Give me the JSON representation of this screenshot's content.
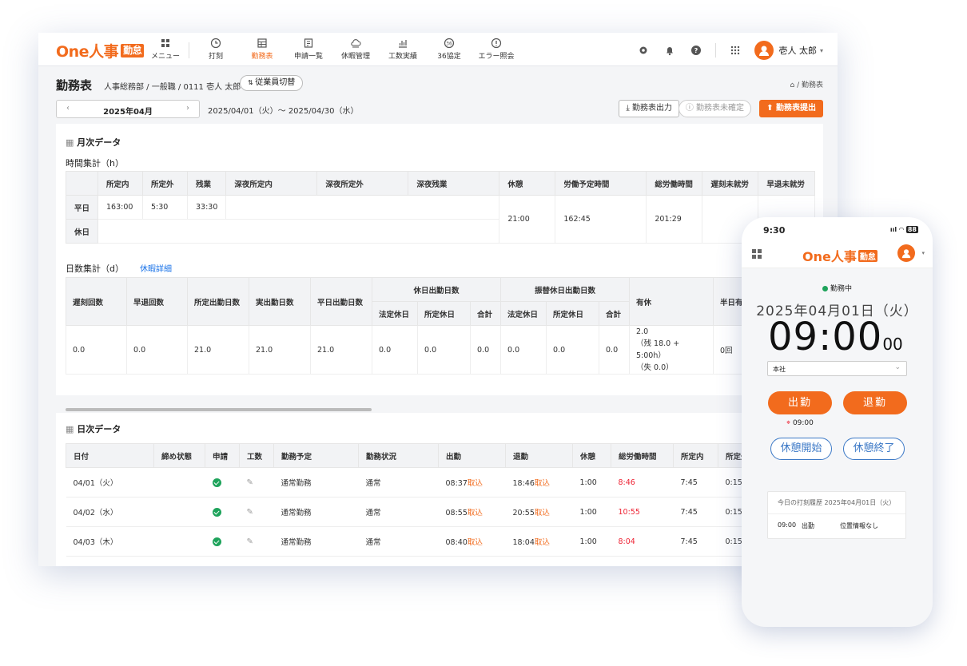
{
  "app": {
    "logo_text": "One人事",
    "logo_badge": "勤怠",
    "brand_color": "#f26b1d"
  },
  "nav": {
    "items": [
      {
        "label": "メニュー",
        "icon": "grid-icon"
      },
      {
        "label": "打刻",
        "icon": "clock-icon"
      },
      {
        "label": "勤務表",
        "icon": "table-icon",
        "active": true
      },
      {
        "label": "申請一覧",
        "icon": "document-icon"
      },
      {
        "label": "休暇管理",
        "icon": "cloud-icon"
      },
      {
        "label": "工数実績",
        "icon": "chart-icon"
      },
      {
        "label": "36協定",
        "icon": "timer-36-icon"
      },
      {
        "label": "エラー照会",
        "icon": "alert-icon"
      }
    ],
    "user_name": "壱人 太郎"
  },
  "page": {
    "title": "勤務表",
    "subtitle": "人事総務部 / 一般職 / 0111 壱人 太郎",
    "switch_button": "従業員切替",
    "breadcrumb": "/ 勤務表",
    "month": "2025年04月",
    "range": "2025/04/01（火）〜 2025/04/30（水）",
    "btn_export": "勤務表出力",
    "btn_unconfirmed": "勤務表未確定",
    "btn_submit": "勤務表提出"
  },
  "monthly": {
    "title": "月次データ",
    "time_title": "時間集計（h）",
    "time_headers": [
      "",
      "所定内",
      "所定外",
      "残業",
      "深夜所定内",
      "深夜所定外",
      "深夜残業",
      "休憩",
      "労働予定時間",
      "総労働時間",
      "遅刻未就労",
      "早退未就労"
    ],
    "row_weekday_label": "平日",
    "row_holiday_label": "休日",
    "weekday": [
      "163:00",
      "5:30",
      "33:30"
    ],
    "rest": "21:00",
    "planned": "162:45",
    "total": "201:29",
    "days_title": "日数集計（d）",
    "leave_link": "休暇詳細",
    "days_headers_top": [
      "遅刻回数",
      "早退回数",
      "所定出勤日数",
      "実出勤日数",
      "平日出勤日数",
      "休日出勤日数",
      "振替休日出勤日数",
      "有休",
      "半日有休"
    ],
    "days_headers_sub": [
      "法定休日",
      "所定休日",
      "合計",
      "法定休日",
      "所定休日",
      "合計"
    ],
    "days_values": [
      "0.0",
      "0.0",
      "21.0",
      "21.0",
      "21.0",
      "0.0",
      "0.0",
      "0.0",
      "0.0",
      "0.0",
      "0.0"
    ],
    "paid_leave_lines": [
      "2.0",
      "（残 18.0 + 5:00h）",
      "（失 0.0）"
    ],
    "half_leave": "0回"
  },
  "daily": {
    "title": "日次データ",
    "headers": [
      "日付",
      "締め状態",
      "申請",
      "工数",
      "勤務予定",
      "勤務状況",
      "出勤",
      "退勤",
      "休憩",
      "総労働時間",
      "所定内",
      "所定外"
    ],
    "tag_label": "取込",
    "rows": [
      {
        "date": "04/01（火）",
        "plan": "通常勤務",
        "status": "通常",
        "in": "08:37",
        "out": "18:46",
        "rest": "1:00",
        "total": "8:46",
        "in_reg": "7:45",
        "out_reg": "0:15"
      },
      {
        "date": "04/02（水）",
        "plan": "通常勤務",
        "status": "通常",
        "in": "08:55",
        "out": "20:55",
        "rest": "1:00",
        "total": "10:55",
        "in_reg": "7:45",
        "out_reg": "0:15"
      },
      {
        "date": "04/03（木）",
        "plan": "通常勤務",
        "status": "通常",
        "in": "08:40",
        "out": "18:04",
        "rest": "1:00",
        "total": "8:04",
        "in_reg": "7:45",
        "out_reg": "0:15"
      }
    ]
  },
  "phone": {
    "time": "9:30",
    "battery": "88",
    "status": "勤務中",
    "date": "2025年04月01日（火）",
    "clock": "09:00",
    "seconds": "00",
    "location": "本社",
    "btn_in": "出勤",
    "btn_out": "退勤",
    "clock_in_time": "09:00",
    "btn_break_start": "休憩開始",
    "btn_break_end": "休憩終了",
    "history_title": "今日の打刻履歴 2025年04月01日（火）",
    "history_time": "09:00",
    "history_type": "出勤",
    "history_loc": "位置情報なし"
  }
}
